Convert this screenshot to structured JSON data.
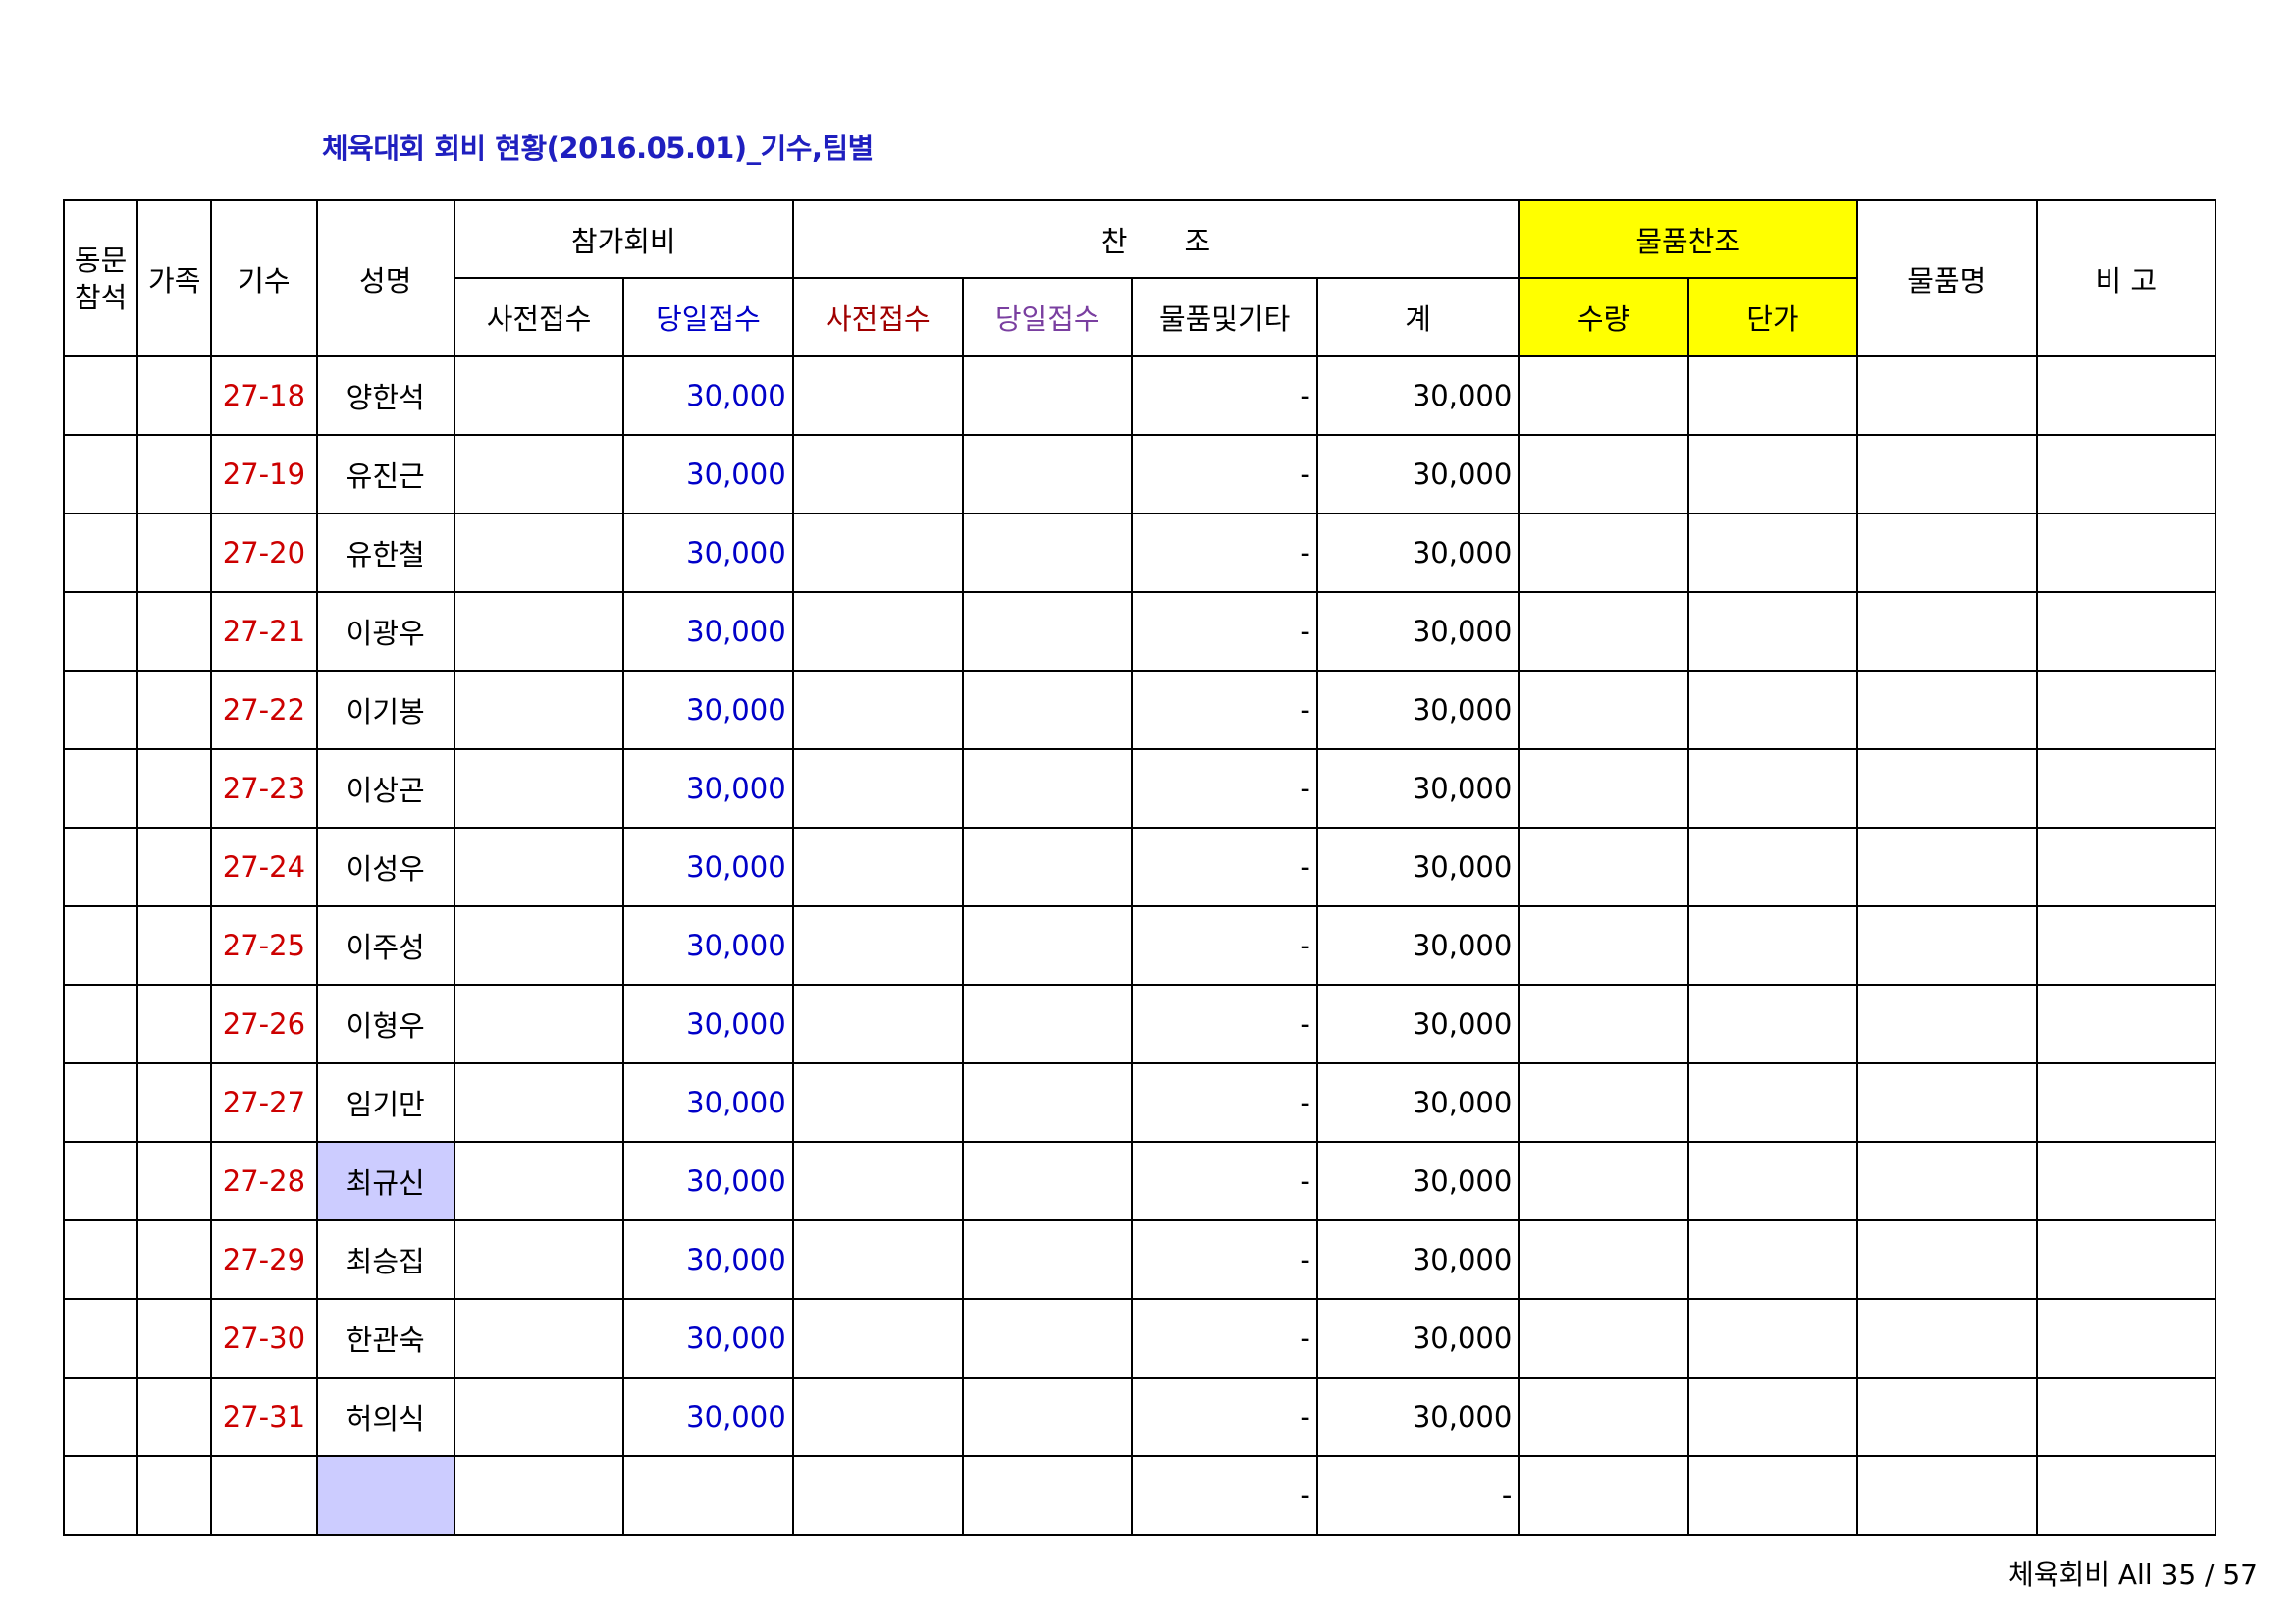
{
  "title": "체육대회 회비 현황(2016.05.01)_기수,팀별",
  "headers": {
    "alumni_attend": "동문\n참석",
    "family": "가족",
    "class_no": "기수",
    "name": "성명",
    "fee_group": "참가회비",
    "fee_pre": "사전접수",
    "fee_day": "당일접수",
    "support_group": "찬　　조",
    "support_pre": "사전접수",
    "support_day": "당일접수",
    "support_goods": "물품및기타",
    "support_total": "계",
    "goods_group": "물품찬조",
    "goods_qty": "수량",
    "goods_price": "단가",
    "goods_name": "물품명",
    "remarks": "비 고"
  },
  "rows": [
    {
      "class_no": "27-18",
      "name": "양한석",
      "fee_day": "30,000",
      "support_goods": "-",
      "support_total": "30,000"
    },
    {
      "class_no": "27-19",
      "name": "유진근",
      "fee_day": "30,000",
      "support_goods": "-",
      "support_total": "30,000"
    },
    {
      "class_no": "27-20",
      "name": "유한철",
      "fee_day": "30,000",
      "support_goods": "-",
      "support_total": "30,000"
    },
    {
      "class_no": "27-21",
      "name": "이광우",
      "fee_day": "30,000",
      "support_goods": "-",
      "support_total": "30,000"
    },
    {
      "class_no": "27-22",
      "name": "이기봉",
      "fee_day": "30,000",
      "support_goods": "-",
      "support_total": "30,000"
    },
    {
      "class_no": "27-23",
      "name": "이상곤",
      "fee_day": "30,000",
      "support_goods": "-",
      "support_total": "30,000"
    },
    {
      "class_no": "27-24",
      "name": "이성우",
      "fee_day": "30,000",
      "support_goods": "-",
      "support_total": "30,000"
    },
    {
      "class_no": "27-25",
      "name": "이주성",
      "fee_day": "30,000",
      "support_goods": "-",
      "support_total": "30,000"
    },
    {
      "class_no": "27-26",
      "name": "이형우",
      "fee_day": "30,000",
      "support_goods": "-",
      "support_total": "30,000"
    },
    {
      "class_no": "27-27",
      "name": "임기만",
      "fee_day": "30,000",
      "support_goods": "-",
      "support_total": "30,000"
    },
    {
      "class_no": "27-28",
      "name": "최규신",
      "fee_day": "30,000",
      "support_goods": "-",
      "support_total": "30,000",
      "highlight": true
    },
    {
      "class_no": "27-29",
      "name": "최승집",
      "fee_day": "30,000",
      "support_goods": "-",
      "support_total": "30,000"
    },
    {
      "class_no": "27-30",
      "name": "한관숙",
      "fee_day": "30,000",
      "support_goods": "-",
      "support_total": "30,000"
    },
    {
      "class_no": "27-31",
      "name": "허의식",
      "fee_day": "30,000",
      "support_goods": "-",
      "support_total": "30,000"
    },
    {
      "class_no": "",
      "name": "",
      "fee_day": "",
      "support_goods": "-",
      "support_total": "-",
      "highlight": true
    }
  ],
  "footer": "체육회비 All 35 / 57",
  "colors": {
    "title": "#1f1fbf",
    "class_no": "#cc0000",
    "fee_day": "#0000c8",
    "goods_header_bg": "#ffff00",
    "highlight_bg": "#ccccff"
  }
}
